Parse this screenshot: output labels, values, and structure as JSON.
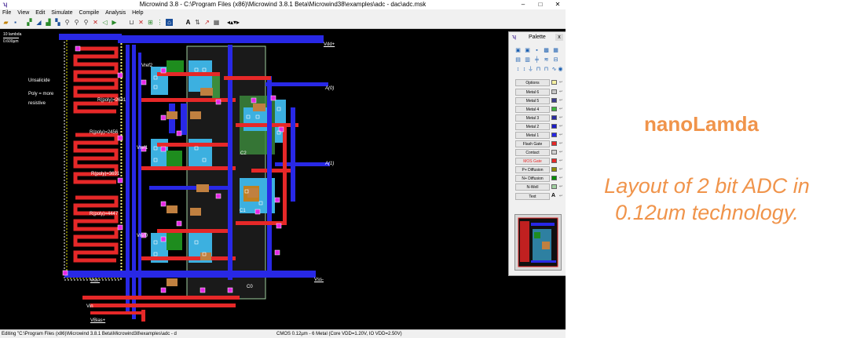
{
  "window": {
    "title": "Microwind 3.8 - C:\\Program Files (x86)\\Microwind 3.8.1 Beta\\Microwind38\\examples\\adc - dac\\adc.msk",
    "minimize_glyph": "–",
    "maximize_glyph": "□",
    "close_glyph": "✕"
  },
  "menu": [
    "File",
    "View",
    "Edit",
    "Simulate",
    "Compile",
    "Analysis",
    "Help"
  ],
  "toolbar_icons": [
    "open-icon",
    "save-icon",
    "draw-box-icon",
    "fill-icon",
    "move-icon",
    "duplicate-icon",
    "zoom-in-icon",
    "zoom-out-icon",
    "simulate-icon",
    "undo-icon",
    "measure-icon",
    "layer-icon",
    "font-icon",
    "text-A-icon",
    "mirror-icon",
    "chart-icon",
    "cross-section-icon",
    "scroll-icon"
  ],
  "canvas": {
    "background": "#000000",
    "scale_label_top": "10 lambda",
    "scale_label_bottom": "0.600µm",
    "labels": {
      "vdd": "Vdd+",
      "a0": "A(0)",
      "a1": "A(1)",
      "vss_right": "Vss-",
      "vss_left": "Vss-",
      "vin": "Vin",
      "vbias": "VBias+",
      "vref2": "Vref2",
      "vref1": "Vref1",
      "vref0": "Vref0",
      "c0": "C0",
      "c1": "C1",
      "c2": "C2",
      "note_1": "Unsalicide",
      "note_2": "Poly = more",
      "note_3": "resistive",
      "r1": "R(poly)=2631",
      "r2": "R(poly)=2456",
      "r3": "R(poly)=3691",
      "r4": "R(poly)=4447"
    }
  },
  "palette": {
    "title": "Palette",
    "close_glyph": "x",
    "options_label": "Options",
    "layers": [
      {
        "name": "Metal 6",
        "color": "#c8c8c8"
      },
      {
        "name": "Metal 5",
        "color": "#3c3c8c"
      },
      {
        "name": "Metal 4",
        "color": "#3cb43c"
      },
      {
        "name": "Metal 3",
        "color": "#2a2aa0"
      },
      {
        "name": "Metal 2",
        "color": "#1e1ec8"
      },
      {
        "name": "Metal 1",
        "color": "#2828e6"
      },
      {
        "name": "Flash Gate",
        "color": "#e62828"
      },
      {
        "name": "Contact",
        "color": "#d0d0d0"
      },
      {
        "name": "MOS Gate",
        "color": "#e62828"
      },
      {
        "name": "P+ Diffusion",
        "color": "#8c8c00"
      },
      {
        "name": "N+ Diffusion",
        "color": "#008c00"
      },
      {
        "name": "N-Well",
        "color": "#a0d0a0"
      }
    ],
    "text_label": "Text",
    "text_glyph": "A"
  },
  "status": {
    "left": "Editing \"C:\\Program Files (x86)\\Microwind 3.8.1 Beta\\Microwind38\\examples\\adc - d",
    "right": "CMOS 0.12µm - 6 Metal (Core VDD=1.20V, IO VDD=2.50V)"
  },
  "branding": {
    "name": "nanoLamda",
    "caption": "Layout of 2 bit ADC in 0.12um technology.",
    "color": "#f0944b"
  }
}
